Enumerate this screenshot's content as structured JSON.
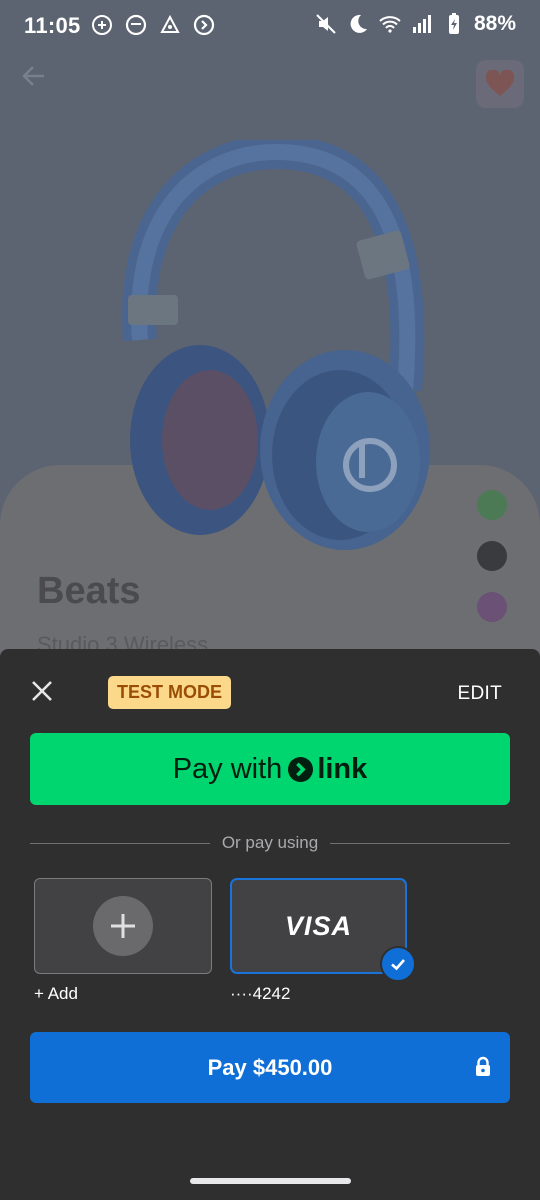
{
  "status_bar": {
    "time": "11:05",
    "battery_percent": "88%",
    "left_icons": [
      "whatsapp-icon",
      "messenger-icon",
      "alert-icon",
      "sync-icon"
    ],
    "right_icons": [
      "mute-icon",
      "moon-icon",
      "wifi-icon",
      "signal-icon",
      "battery-icon"
    ]
  },
  "product": {
    "title": "Beats",
    "subtitle": "Studio 3 Wireless",
    "colors": [
      "#4c7a55",
      "#3a3b3e",
      "#6a5175"
    ]
  },
  "sheet": {
    "test_mode_label": "TEST MODE",
    "edit_label": "EDIT",
    "link_button": {
      "prefix": "Pay with",
      "brand": "link"
    },
    "divider_text": "Or pay using",
    "payment_methods": [
      {
        "label": "+ Add",
        "icon": "plus-icon"
      },
      {
        "label": "····4242",
        "brand": "VISA",
        "selected": true
      }
    ],
    "pay_button_label": "Pay $450.00"
  },
  "colors": {
    "link_green": "#00d66f",
    "primary_blue": "#0f6fd6",
    "sheet_bg": "#2f2f30",
    "test_badge_bg": "#fcd98a"
  }
}
